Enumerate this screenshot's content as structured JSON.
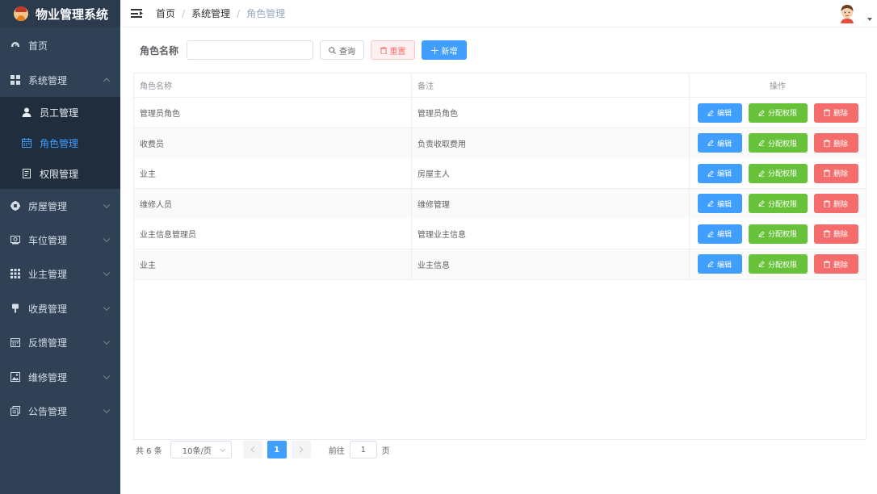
{
  "app": {
    "title": "物业管理系统"
  },
  "sidebar": {
    "items": [
      {
        "label": "首页",
        "icon": "dashboard-icon"
      },
      {
        "label": "系统管理",
        "icon": "grid-icon",
        "expanded": true
      },
      {
        "label": "房屋管理",
        "icon": "help-circle-icon"
      },
      {
        "label": "车位管理",
        "icon": "money-icon"
      },
      {
        "label": "业主管理",
        "icon": "apps-icon"
      },
      {
        "label": "收费管理",
        "icon": "goblet-icon"
      },
      {
        "label": "反馈管理",
        "icon": "date-icon"
      },
      {
        "label": "维修管理",
        "icon": "picture-icon"
      },
      {
        "label": "公告管理",
        "icon": "copy-document-icon"
      }
    ],
    "submenu": [
      {
        "label": "员工管理",
        "icon": "user-icon",
        "active": false
      },
      {
        "label": "角色管理",
        "icon": "calendar-icon",
        "active": true
      },
      {
        "label": "权限管理",
        "icon": "tickets-icon",
        "active": false
      }
    ]
  },
  "header": {
    "breadcrumb": [
      "首页",
      "系统管理",
      "角色管理"
    ],
    "separator": "/"
  },
  "search": {
    "label": "角色名称",
    "value": "",
    "placeholder": "",
    "query_label": "查询",
    "reset_label": "重置",
    "add_label": "新增"
  },
  "table": {
    "columns": [
      "角色名称",
      "备注",
      "操作"
    ],
    "actions": {
      "edit": "编辑",
      "assign": "分配权限",
      "delete": "删除"
    },
    "rows": [
      {
        "name": "管理员角色",
        "remark": "管理员角色"
      },
      {
        "name": "收费员",
        "remark": "负责收取费用"
      },
      {
        "name": "业主",
        "remark": "房屋主人"
      },
      {
        "name": "维修人员",
        "remark": "维修管理"
      },
      {
        "name": "业主信息管理员",
        "remark": "管理业主信息"
      },
      {
        "name": "业主",
        "remark": "业主信息"
      }
    ]
  },
  "pagination": {
    "total": "共 6 条",
    "page_size": "10条/页",
    "current_page": "1",
    "goto_label": "前往",
    "goto_value": "1",
    "page_suffix": "页"
  },
  "colors": {
    "sidebar_bg": "#304156",
    "submenu_bg": "#1f2d3d",
    "primary": "#409eff",
    "success": "#67c23a",
    "danger": "#f56c6c"
  }
}
